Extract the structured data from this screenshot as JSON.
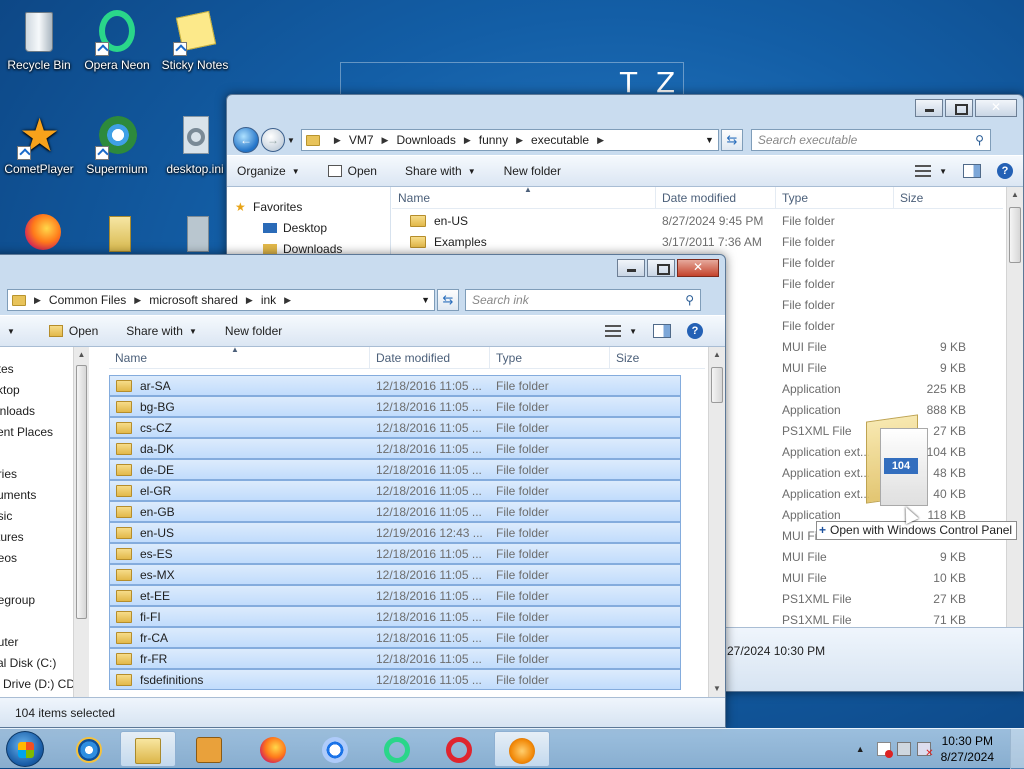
{
  "desktop": {
    "icons": [
      {
        "label": "Recycle Bin"
      },
      {
        "label": "Opera Neon"
      },
      {
        "label": "Sticky Notes"
      },
      {
        "label": "CometPlayer"
      },
      {
        "label": "Supermium"
      },
      {
        "label": "desktop.ini"
      }
    ],
    "bg_letters": [
      "T",
      "Z"
    ]
  },
  "back_window": {
    "breadcrumb": [
      "VM7",
      "Downloads",
      "funny",
      "executable"
    ],
    "search_placeholder": "Search executable",
    "toolbar": {
      "organize": "Organize",
      "open": "Open",
      "share_with": "Share with",
      "new_folder": "New folder"
    },
    "nav": [
      "Favorites",
      "Desktop",
      "Downloads"
    ],
    "columns": {
      "name": "Name",
      "date": "Date modified",
      "type": "Type",
      "size": "Size"
    },
    "rows": [
      {
        "name": "en-US",
        "date": "8/27/2024 9:45 PM",
        "type": "File folder",
        "size": ""
      },
      {
        "name": "Examples",
        "date": "3/17/2011 7:36 AM",
        "type": "File folder",
        "size": ""
      },
      {
        "name": "",
        "date": ":54 PM",
        "type": "File folder",
        "size": ""
      },
      {
        "name": "",
        "date": ":36 AM",
        "type": "File folder",
        "size": ""
      },
      {
        "name": "",
        "date": ":01 AM",
        "type": "File folder",
        "size": ""
      },
      {
        "name": "",
        "date": ":06 AM",
        "type": "File folder",
        "size": ""
      },
      {
        "name": "",
        "date": "12:41 ...",
        "type": "MUI File",
        "size": "9 KB"
      },
      {
        "name": "",
        "date": "12:41 ...",
        "type": "MUI File",
        "size": "9 KB"
      },
      {
        "name": "",
        "date": "12:41 ...",
        "type": "Application",
        "size": "225 KB"
      },
      {
        "name": "",
        "date": "22 AM",
        "type": "Application",
        "size": "888 KB"
      },
      {
        "name": "",
        "date": "10:29 PM",
        "type": "PS1XML File",
        "size": "27 KB"
      },
      {
        "name": "",
        "date": "3:33 AM",
        "type": "Application ext...",
        "size": "104 KB"
      },
      {
        "name": "",
        "date": "3:37 AM",
        "type": "Application ext...",
        "size": "48 KB"
      },
      {
        "name": "",
        "date": "3:04 AM",
        "type": "Application ext...",
        "size": "40 KB"
      },
      {
        "name": "",
        "date": "3:37 AM",
        "type": "Application",
        "size": "118 KB"
      },
      {
        "name": "",
        "date": "12:42 ...",
        "type": "MUI File",
        "size": "9 KB"
      },
      {
        "name": "",
        "date": "12:42 ...",
        "type": "MUI File",
        "size": "9 KB"
      },
      {
        "name": "",
        "date": "12:41 ...",
        "type": "MUI File",
        "size": "10 KB"
      },
      {
        "name": "",
        "date": "10:29 PM",
        "type": "PS1XML File",
        "size": "27 KB"
      },
      {
        "name": "",
        "date": "10:29 PM",
        "type": "PS1XML File",
        "size": "71 KB"
      }
    ],
    "status": "27/2024 10:30 PM"
  },
  "front_window": {
    "breadcrumb": [
      "Common Files",
      "microsoft shared",
      "ink"
    ],
    "search_placeholder": "Search ink",
    "toolbar": {
      "open": "Open",
      "share_with": "Share with",
      "new_folder": "New folder"
    },
    "nav": [
      "rites",
      "sktop",
      "wnloads",
      "cent Places",
      "",
      "aries",
      "cuments",
      "usic",
      "ctures",
      "deos",
      "",
      "negroup",
      "",
      "puter",
      "cal Disk (C:)",
      "D Drive (D:) CDI"
    ],
    "columns": {
      "name": "Name",
      "date": "Date modified",
      "type": "Type",
      "size": "Size"
    },
    "rows": [
      {
        "name": "ar-SA",
        "date": "12/18/2016 11:05 ...",
        "type": "File folder"
      },
      {
        "name": "bg-BG",
        "date": "12/18/2016 11:05 ...",
        "type": "File folder"
      },
      {
        "name": "cs-CZ",
        "date": "12/18/2016 11:05 ...",
        "type": "File folder"
      },
      {
        "name": "da-DK",
        "date": "12/18/2016 11:05 ...",
        "type": "File folder"
      },
      {
        "name": "de-DE",
        "date": "12/18/2016 11:05 ...",
        "type": "File folder"
      },
      {
        "name": "el-GR",
        "date": "12/18/2016 11:05 ...",
        "type": "File folder"
      },
      {
        "name": "en-GB",
        "date": "12/18/2016 11:05 ...",
        "type": "File folder"
      },
      {
        "name": "en-US",
        "date": "12/19/2016 12:43 ...",
        "type": "File folder"
      },
      {
        "name": "es-ES",
        "date": "12/18/2016 11:05 ...",
        "type": "File folder"
      },
      {
        "name": "es-MX",
        "date": "12/18/2016 11:05 ...",
        "type": "File folder"
      },
      {
        "name": "et-EE",
        "date": "12/18/2016 11:05 ...",
        "type": "File folder"
      },
      {
        "name": "fi-FI",
        "date": "12/18/2016 11:05 ...",
        "type": "File folder"
      },
      {
        "name": "fr-CA",
        "date": "12/18/2016 11:05 ...",
        "type": "File folder"
      },
      {
        "name": "fr-FR",
        "date": "12/18/2016 11:05 ...",
        "type": "File folder"
      },
      {
        "name": "fsdefinitions",
        "date": "12/18/2016 11:05 ...",
        "type": "File folder"
      }
    ],
    "status": "104 items selected"
  },
  "drag": {
    "badge": "104",
    "tooltip": "Open with Windows Control Panel"
  },
  "taskbar": {
    "clock_time": "10:30 PM",
    "clock_date": "8/27/2024",
    "apps": [
      "internet-explorer",
      "file-explorer",
      "media-player",
      "firefox",
      "chromium",
      "opera-neon",
      "opera",
      "vlc"
    ]
  },
  "colors": {
    "selection": "#c1dcfc",
    "selection_border": "#84acdd",
    "desktop": "#135ea6"
  }
}
